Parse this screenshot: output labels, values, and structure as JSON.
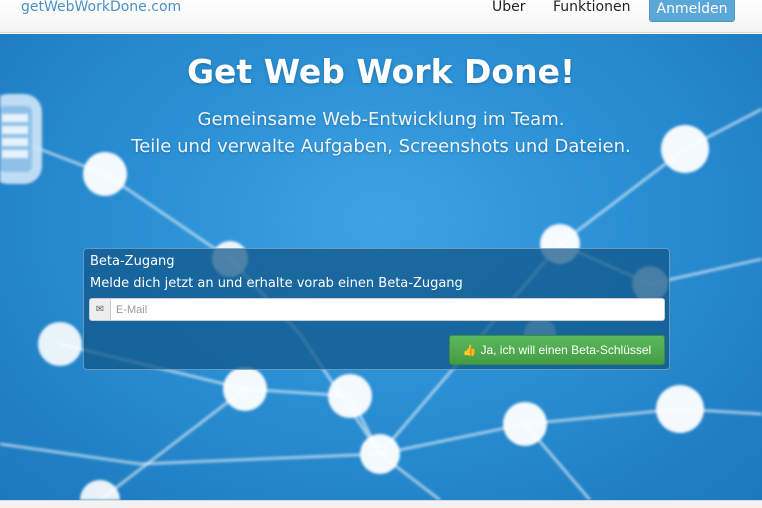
{
  "navbar": {
    "brand": "getWebWorkDone.com",
    "links": [
      "Über",
      "Funktionen"
    ],
    "login_label": "Anmelden"
  },
  "hero": {
    "title": "Get Web Work Done!",
    "subtitle_line1": "Gemeinsame Web-Entwicklung im Team.",
    "subtitle_line2": "Teile und verwalte Aufgaben, Screenshots und Dateien."
  },
  "beta": {
    "heading": "Beta-Zugang",
    "description": "Melde dich jetzt an und erhalte vorab einen Beta-Zugang",
    "email_placeholder": "E-Mail",
    "email_icon": "envelope-icon",
    "submit_label": "Ja, ich will einen Beta-Schlüssel",
    "submit_icon": "thumbs-up-icon"
  },
  "colors": {
    "brand": "#4a90c8",
    "login_button": "#5ba7d8",
    "hero_background": "#2a8fd4",
    "submit_button": "#5cb85c"
  }
}
